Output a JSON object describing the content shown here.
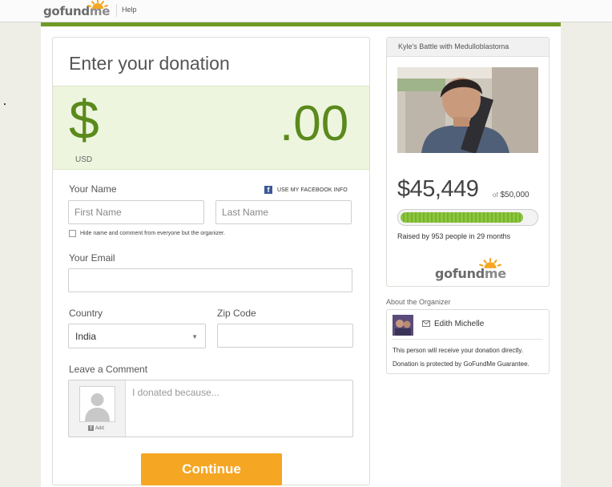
{
  "header": {
    "logo_text_go": "go",
    "logo_text_fund": "fund",
    "logo_text_me": "me",
    "help_label": "Help"
  },
  "donation": {
    "title": "Enter your donation",
    "currency_symbol": "$",
    "currency_code": "USD",
    "cents": ".00"
  },
  "form": {
    "your_name_label": "Your Name",
    "facebook_label": "USE MY FACEBOOK INFO",
    "first_name_placeholder": "First Name",
    "last_name_placeholder": "Last Name",
    "hide_name_label": "Hide name and comment from everyone but the organizer.",
    "email_label": "Your Email",
    "country_label": "Country",
    "country_value": "India",
    "zip_label": "Zip Code",
    "comment_label": "Leave a Comment",
    "comment_placeholder": "I donated because...",
    "fb_add_label": "Add",
    "continue_label": "Continue"
  },
  "campaign": {
    "title": "Kyle's Battle with Medulloblastoma",
    "raised": "$45,449",
    "goal_prefix": "of",
    "goal": "$50,000",
    "progress_fraction": 0.909,
    "raised_by": "Raised by 953 people in 29 months"
  },
  "organizer": {
    "section_label": "About the Organizer",
    "name": "Edith Michelle",
    "note_1": "This person will receive your donation directly.",
    "note_2": "Donation is protected by GoFundMe Guarantee."
  },
  "colors": {
    "brand_green": "#5a8a1c",
    "accent_orange": "#f5a623",
    "progress_green": "#8cc63f"
  }
}
